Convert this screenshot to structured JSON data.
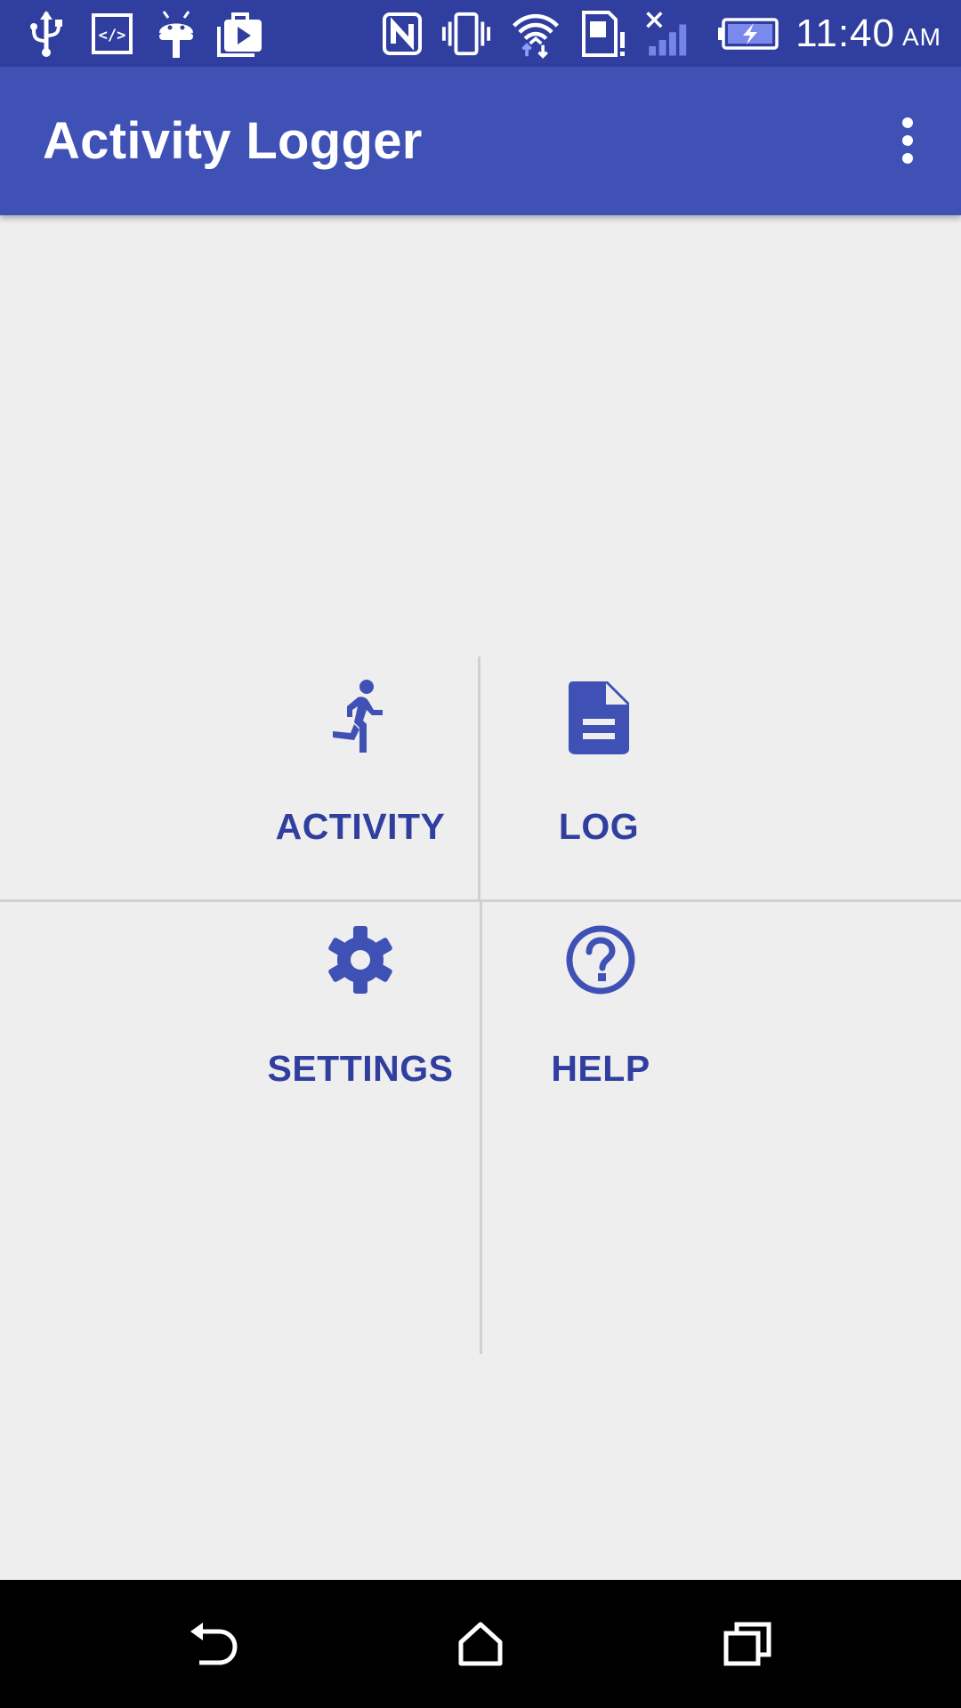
{
  "status_bar": {
    "time": "11:40",
    "ampm": "AM",
    "left_icons": [
      "usb-icon",
      "developer-code-icon",
      "android-debug-icon",
      "play-store-bag-icon"
    ],
    "right_icons": [
      "nfc-icon",
      "vibrate-icon",
      "wifi-icon",
      "sim-alert-icon",
      "signal-off-icon",
      "battery-charging-icon"
    ]
  },
  "app_bar": {
    "title": "Activity Logger",
    "menu_icon": "more-vert-icon"
  },
  "tiles": [
    {
      "label": "ACTIVITY",
      "icon": "run-icon"
    },
    {
      "label": "LOG",
      "icon": "document-icon"
    },
    {
      "label": "SETTINGS",
      "icon": "gear-icon"
    },
    {
      "label": "HELP",
      "icon": "help-circle-icon"
    }
  ],
  "nav_bar": {
    "buttons": [
      "back-icon",
      "home-icon",
      "recents-icon"
    ]
  },
  "colors": {
    "status_bar": "#303F9F",
    "app_bar": "#3F51B5",
    "accent": "#3F51B5",
    "label": "#303F9F",
    "background": "#EEEEEF",
    "nav_bar": "#000000"
  }
}
